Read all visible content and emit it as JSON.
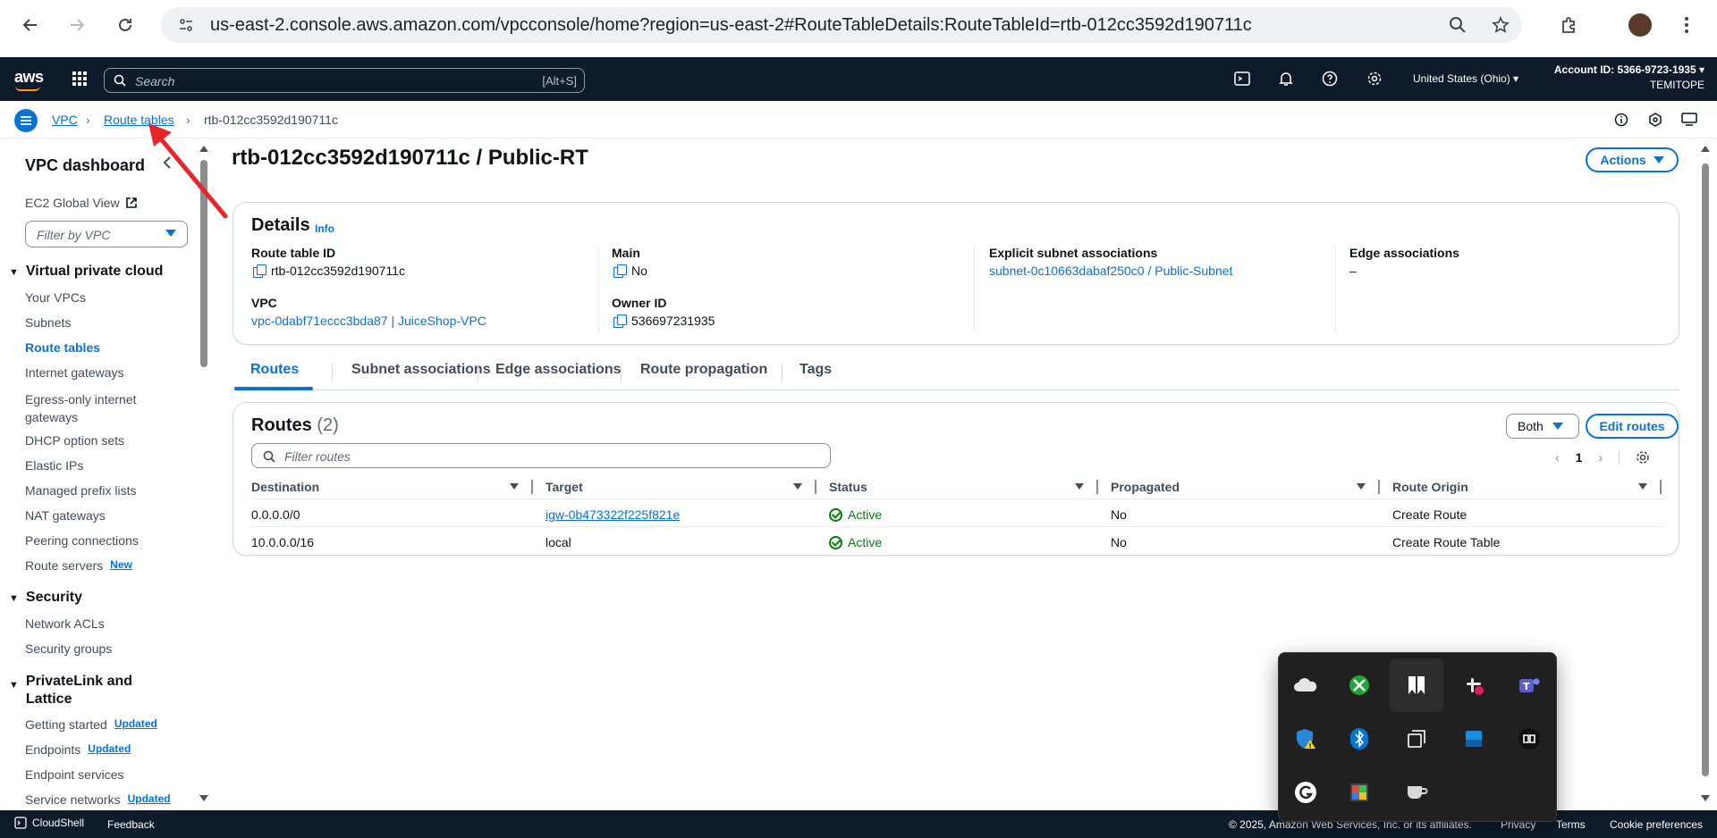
{
  "browser": {
    "url": "us-east-2.console.aws.amazon.com/vpcconsole/home?region=us-east-2#RouteTableDetails:RouteTableId=rtb-012cc3592d190711c"
  },
  "aws_nav": {
    "logo": "aws",
    "search_placeholder": "Search",
    "search_hint": "[Alt+S]",
    "region": "United States (Ohio) ▾",
    "account_id": "Account ID: 5366-9723-1935 ▾",
    "account_name": "TEMITOPE"
  },
  "breadcrumb": {
    "items": [
      "VPC",
      "Route tables",
      "rtb-012cc3592d190711c"
    ]
  },
  "sidebar": {
    "title": "VPC dashboard",
    "global_view": "EC2 Global View",
    "filter_placeholder": "Filter by VPC",
    "sections": [
      {
        "label": "Virtual private cloud",
        "items": [
          "Your VPCs",
          "Subnets",
          "Route tables",
          "Internet gateways",
          "Egress-only internet gateways",
          "DHCP option sets",
          "Elastic IPs",
          "Managed prefix lists",
          "NAT gateways",
          "Peering connections",
          "Route servers"
        ]
      },
      {
        "label": "Security",
        "items": [
          "Network ACLs",
          "Security groups"
        ]
      },
      {
        "label": "PrivateLink and Lattice",
        "items": [
          "Getting started",
          "Endpoints",
          "Endpoint services",
          "Service networks"
        ]
      }
    ],
    "badges": {
      "new": "New",
      "updated": "Updated"
    }
  },
  "page": {
    "title": "rtb-012cc3592d190711c / Public-RT",
    "actions_label": "Actions"
  },
  "details": {
    "heading": "Details",
    "info": "Info",
    "route_table_id_label": "Route table ID",
    "route_table_id": "rtb-012cc3592d190711c",
    "main_label": "Main",
    "main": "No",
    "subnet_assoc_label": "Explicit subnet associations",
    "subnet_assoc": "subnet-0c10663dabaf250c0 / Public-Subnet",
    "edge_assoc_label": "Edge associations",
    "edge_assoc": "–",
    "vpc_label": "VPC",
    "vpc": "vpc-0dabf71eccc3bda87 | JuiceShop-VPC",
    "owner_label": "Owner ID",
    "owner": "536697231935"
  },
  "tabs": [
    "Routes",
    "Subnet associations",
    "Edge associations",
    "Route propagation",
    "Tags"
  ],
  "routes": {
    "heading": "Routes",
    "count": "(2)",
    "both_label": "Both",
    "edit_label": "Edit routes",
    "filter_placeholder": "Filter routes",
    "page": "1",
    "columns": [
      "Destination",
      "Target",
      "Status",
      "Propagated",
      "Route Origin"
    ],
    "rows": [
      {
        "destination": "0.0.0.0/0",
        "target": "igw-0b473322f225f821e",
        "status": "Active",
        "propagated": "No",
        "origin": "Create Route"
      },
      {
        "destination": "10.0.0.0/16",
        "target": "local",
        "status": "Active",
        "propagated": "No",
        "origin": "Create Route Table"
      }
    ]
  },
  "footer": {
    "cloudshell": "CloudShell",
    "feedback": "Feedback",
    "copyright": "© 2025, Amazon Web Services, Inc. or its affiliates.",
    "privacy": "Privacy",
    "terms": "Terms",
    "cookies": "Cookie preferences"
  },
  "colors": {
    "link": "#0972d3",
    "nav_bg": "#0f1b2a",
    "success": "#037f0c",
    "annotation": "#e8252a"
  },
  "tray_icons": [
    "onedrive-icon",
    "xbox-icon",
    "snip-icon",
    "slack-icon",
    "teams-icon",
    "defender-icon",
    "bluetooth-icon",
    "copy-icon",
    "app-icon",
    "capcut-icon",
    "grammarly-icon",
    "colorpicker-icon",
    "cup-icon"
  ]
}
